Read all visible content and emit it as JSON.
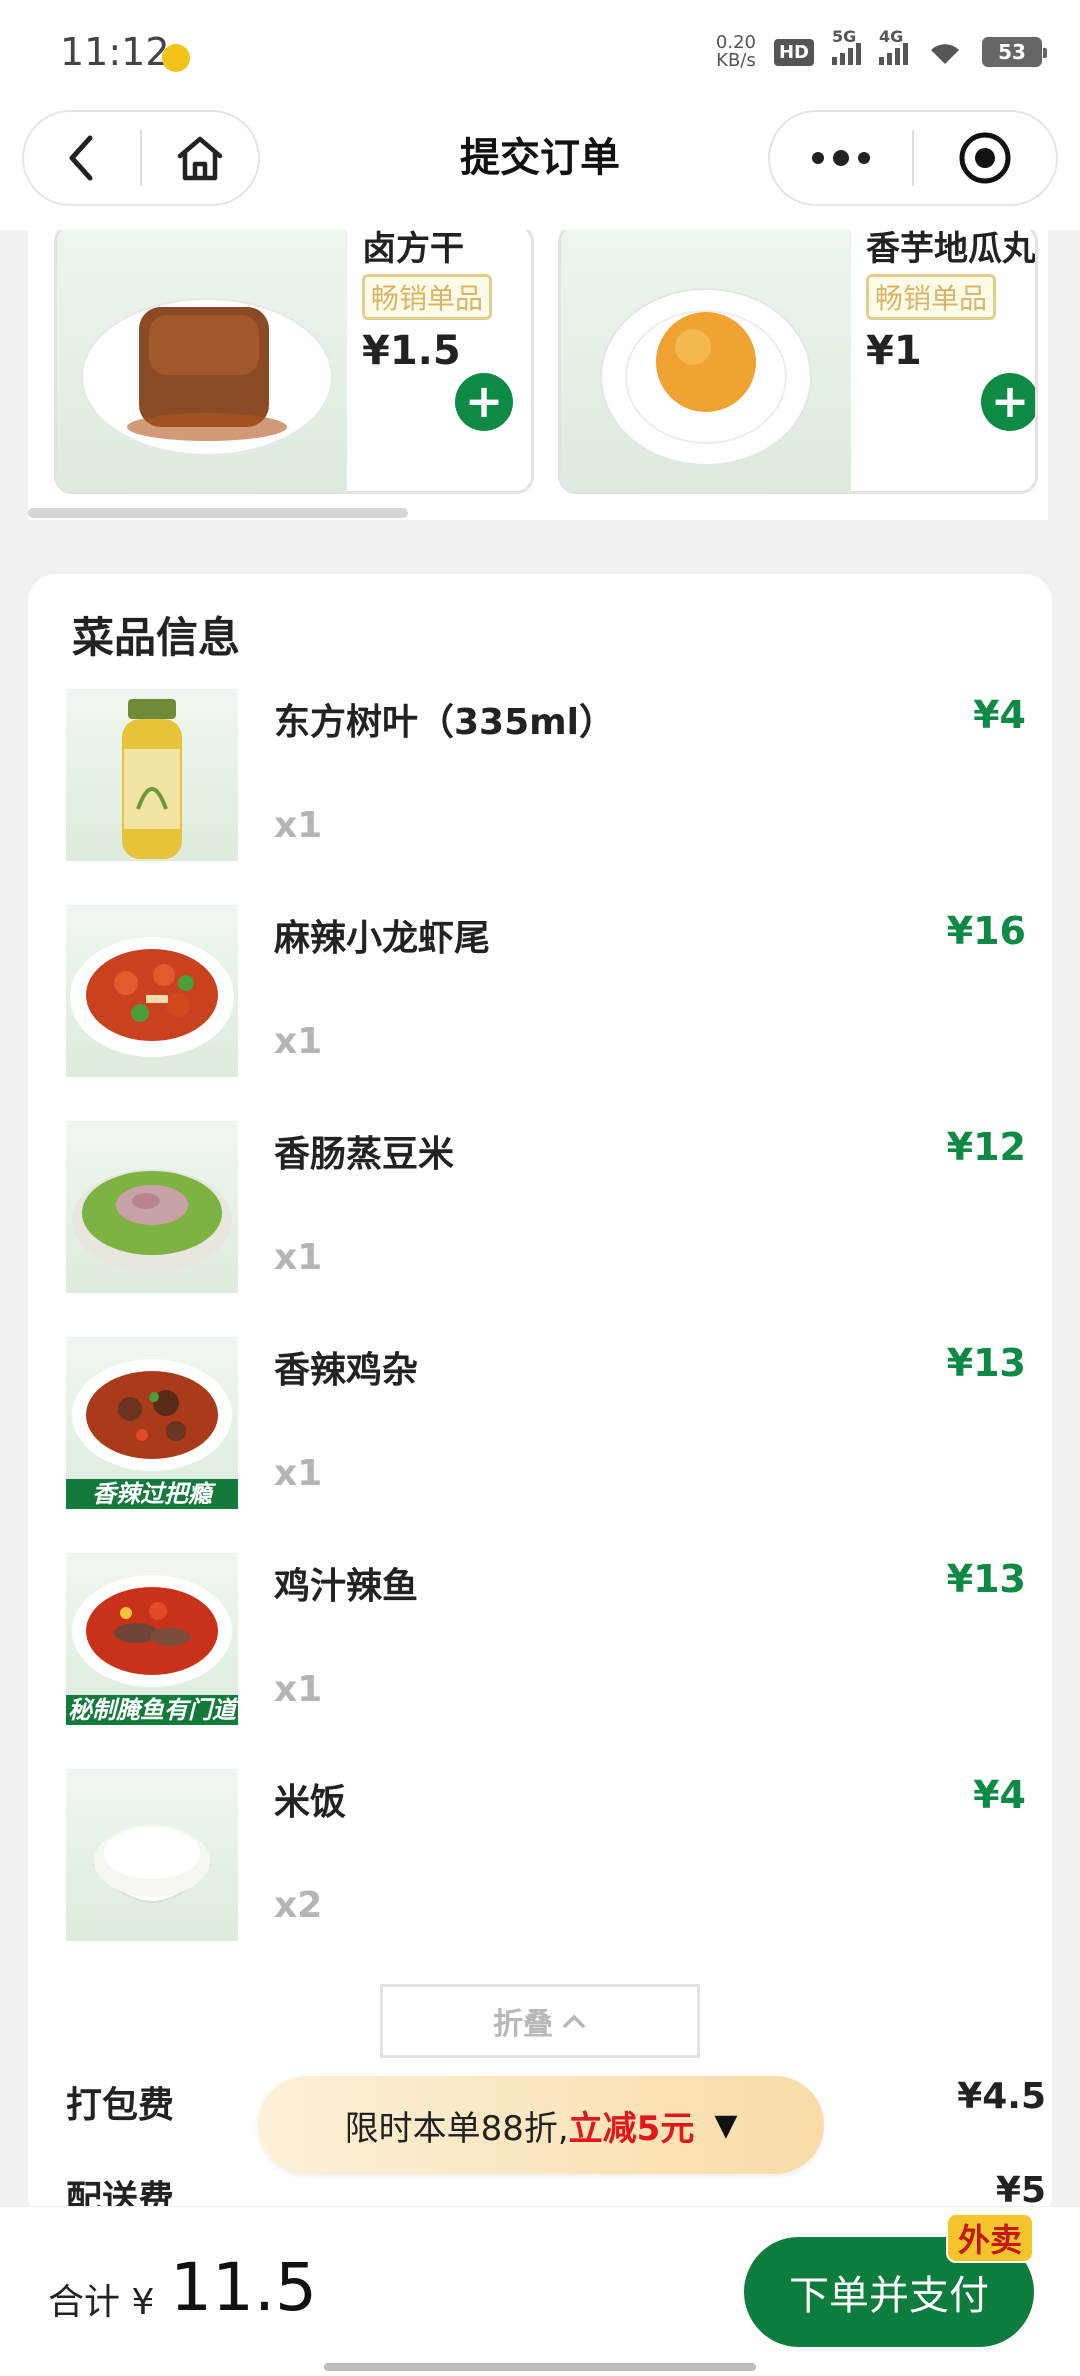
{
  "status": {
    "time": "11:12",
    "net_speed": "0.20",
    "net_unit": "KB/s",
    "hd_label": "HD",
    "sim1": "5G",
    "sim2": "4G",
    "battery": "53"
  },
  "nav": {
    "title": "提交订单"
  },
  "recommendations": [
    {
      "name": "卤方干",
      "badge": "畅销单品",
      "price": "¥1.5"
    },
    {
      "name": "香芋地瓜丸",
      "badge": "畅销单品",
      "price": "¥1"
    }
  ],
  "dishes_section": {
    "title": "菜品信息",
    "items": [
      {
        "name": "东方树叶（335ml）",
        "qty": "x1",
        "price": "¥4",
        "tagline": ""
      },
      {
        "name": "麻辣小龙虾尾",
        "qty": "x1",
        "price": "¥16",
        "tagline": ""
      },
      {
        "name": "香肠蒸豆米",
        "qty": "x1",
        "price": "¥12",
        "tagline": ""
      },
      {
        "name": "香辣鸡杂",
        "qty": "x1",
        "price": "¥13",
        "tagline": "香辣过把瘾"
      },
      {
        "name": "鸡汁辣鱼",
        "qty": "x1",
        "price": "¥13",
        "tagline": "秘制腌鱼有门道"
      },
      {
        "name": "米饭",
        "qty": "x2",
        "price": "¥4",
        "tagline": ""
      }
    ],
    "fold_label": "折叠",
    "fees": [
      {
        "label": "打包费",
        "value": "¥4.5"
      },
      {
        "label": "配送费",
        "value": "¥5"
      }
    ]
  },
  "promo": {
    "text": "限时本单88折,",
    "highlight": "立减5元",
    "arrow": "▼"
  },
  "footer": {
    "total_label": "合计 ¥",
    "total_value": "11.5",
    "pay_label": "下单并支付",
    "pay_tag": "外卖"
  },
  "colors": {
    "brand_green": "#0d8b45",
    "promo_red": "#e3161c",
    "badge_gold": "#d8b567",
    "tag_yellow": "#f6c42d"
  }
}
